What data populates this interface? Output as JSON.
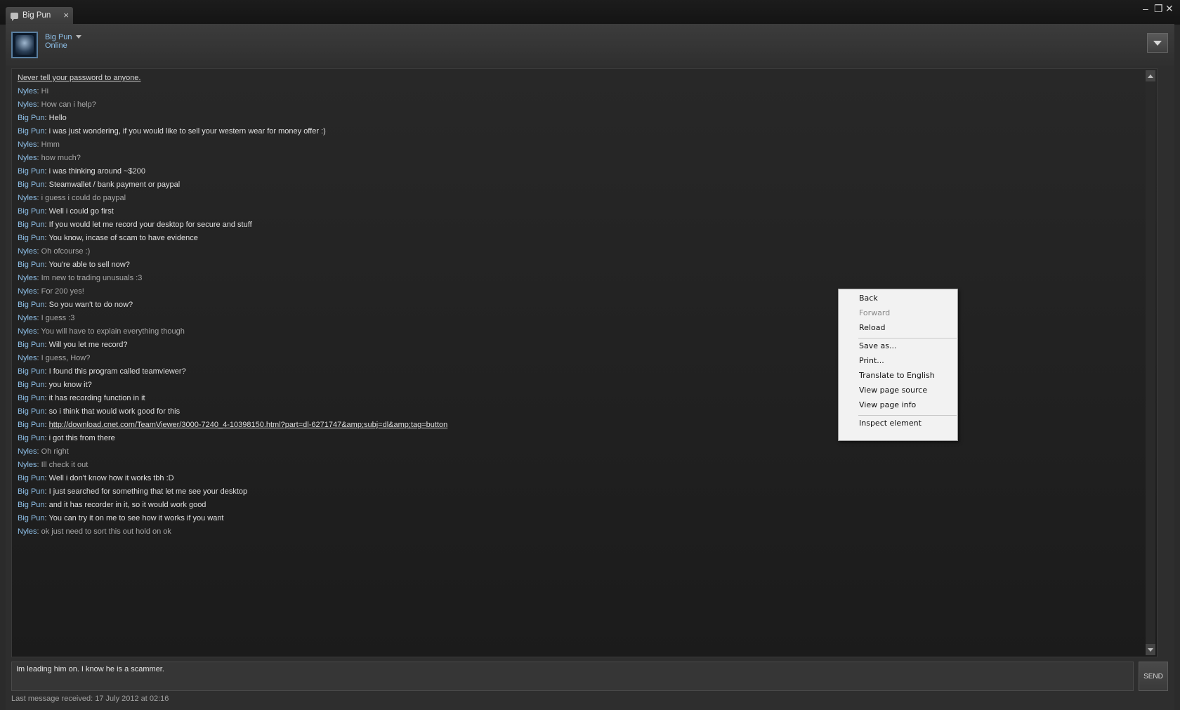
{
  "window": {
    "tab_title": "Big Pun",
    "tab_close": "×",
    "minimize": "–",
    "restore": "❐",
    "close": "✕"
  },
  "friend": {
    "name": "Big Pun",
    "status": "Online"
  },
  "chat": {
    "notice": "Never tell your password to anyone.",
    "messages": [
      {
        "who": "Nyles",
        "text": ": Hi"
      },
      {
        "who": "Nyles",
        "text": ": How can i help?"
      },
      {
        "who": "Big Pun",
        "text": ": Hello"
      },
      {
        "who": "Big Pun",
        "text": ": i was just wondering, if you would like to sell your western wear for money offer :)"
      },
      {
        "who": "Nyles",
        "text": ": Hmm"
      },
      {
        "who": "Nyles",
        "text": ": how much?"
      },
      {
        "who": "Big Pun",
        "text": ": i was thinking around ~$200"
      },
      {
        "who": "Big Pun",
        "text": ": Steamwallet / bank payment or paypal"
      },
      {
        "who": "Nyles",
        "text": ": i guess i could do paypal"
      },
      {
        "who": "Big Pun",
        "text": ": Well i could go first"
      },
      {
        "who": "Big Pun",
        "text": ": If you would let me record your desktop for secure and stuff"
      },
      {
        "who": "Big Pun",
        "text": ": You know, incase of scam to have evidence"
      },
      {
        "who": "Nyles",
        "text": ": Oh ofcourse :)"
      },
      {
        "who": "Big Pun",
        "text": ": You're able to sell now?"
      },
      {
        "who": "Nyles",
        "text": ": Im new to trading unusuals :3"
      },
      {
        "who": "Nyles",
        "text": ": For 200 yes!"
      },
      {
        "who": "Big Pun",
        "text": ": So you wan't to do now?"
      },
      {
        "who": "Nyles",
        "text": ": I guess :3"
      },
      {
        "who": "Nyles",
        "text": ": You will have to explain everything though"
      },
      {
        "who": "Big Pun",
        "text": ": Will you let me record?"
      },
      {
        "who": "Nyles",
        "text": ": I guess, How?"
      },
      {
        "who": "Big Pun",
        "text": ": I found this program called teamviewer?"
      },
      {
        "who": "Big Pun",
        "text": ": you know it?"
      },
      {
        "who": "Big Pun",
        "text": ": it has recording function in it"
      },
      {
        "who": "Big Pun",
        "text": ": so i think that would work good for this"
      },
      {
        "who": "Big Pun",
        "text": ": ",
        "link": "http://download.cnet.com/TeamViewer/3000-7240_4-10398150.html?part=dl-6271747&amp;subj=dl&amp;tag=button"
      },
      {
        "who": "Big Pun",
        "text": ": i got this from there"
      },
      {
        "who": "Nyles",
        "text": ": Oh right"
      },
      {
        "who": "Nyles",
        "text": ": Ill check it out"
      },
      {
        "who": "Big Pun",
        "text": ": Well i don't know how it works tbh :D"
      },
      {
        "who": "Big Pun",
        "text": ": I just searched for something that let me see your desktop"
      },
      {
        "who": "Big Pun",
        "text": ": and it has recorder in it, so it would work good"
      },
      {
        "who": "Big Pun",
        "text": ": You can try it on me to see how it works if you want"
      },
      {
        "who": "Nyles",
        "text": ": ok just need to sort this out hold on ok"
      }
    ]
  },
  "input": {
    "value": "Im leading him on. I know he is a scammer.",
    "send_label": "SEND"
  },
  "footer": {
    "last_message": "Last message received: 17 July 2012 at 02:16"
  },
  "context_menu": {
    "items": [
      {
        "label": "Back",
        "enabled": true
      },
      {
        "label": "Forward",
        "enabled": false
      },
      {
        "label": "Reload",
        "enabled": true
      },
      {
        "label": "Save as...",
        "enabled": true
      },
      {
        "label": "Print...",
        "enabled": true
      },
      {
        "label": "Translate to English",
        "enabled": true
      },
      {
        "label": "View page source",
        "enabled": true
      },
      {
        "label": "View page info",
        "enabled": true
      },
      {
        "label": "Inspect element",
        "enabled": true
      }
    ]
  },
  "colors": {
    "name_accent": "#8fc1ea",
    "background": "#2b2b2b"
  }
}
